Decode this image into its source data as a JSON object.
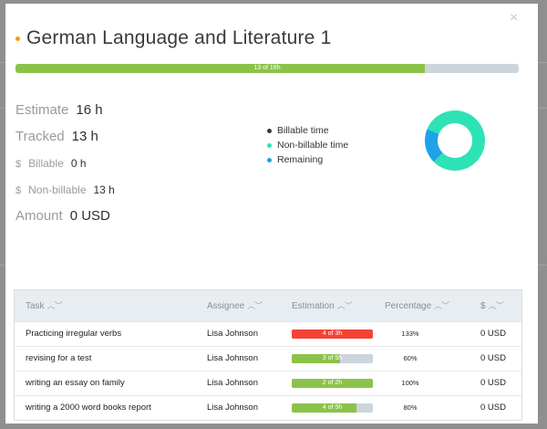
{
  "modal": {
    "title": "German Language and Literature 1",
    "close_glyph": "×",
    "progress": {
      "label": "13 of 16h",
      "fraction": 0.8125,
      "color": "#8bc34a"
    }
  },
  "stats": {
    "estimate": {
      "label": "Estimate",
      "value": "16 h"
    },
    "tracked": {
      "label": "Tracked",
      "value": "13 h"
    },
    "billable": {
      "label": "Billable",
      "value": "0 h",
      "icon": "$"
    },
    "nonbillable": {
      "label": "Non-billable",
      "value": "13 h",
      "icon": "$"
    },
    "amount": {
      "label": "Amount",
      "value": "0 USD"
    }
  },
  "legend": [
    {
      "label": "Billable time",
      "color": "#2f3b45"
    },
    {
      "label": "Non-billable time",
      "color": "#2de3b5"
    },
    {
      "label": "Remaining",
      "color": "#1fa3e8"
    }
  ],
  "donut": {
    "billable": 0,
    "nonbillable": 13,
    "remaining": 3
  },
  "table": {
    "headers": [
      "Task",
      "Assignee",
      "Estimation",
      "Percentage",
      "$"
    ],
    "sort_glyph": "︿﹀",
    "rows": [
      {
        "task": "Practicing irregular verbs",
        "assignee": "Lisa Johnson",
        "estimation": "4 of 3h",
        "fraction": 1.0,
        "color": "#f44336",
        "percentage": "133%",
        "amount": "0 USD"
      },
      {
        "task": "revising for a test",
        "assignee": "Lisa Johnson",
        "estimation": "3 of 5h",
        "fraction": 0.6,
        "color": "#8bc34a",
        "percentage": "60%",
        "amount": "0 USD"
      },
      {
        "task": "writing an essay on family",
        "assignee": "Lisa Johnson",
        "estimation": "2 of 2h",
        "fraction": 1.0,
        "color": "#8bc34a",
        "percentage": "100%",
        "amount": "0 USD"
      },
      {
        "task": "writing a 2000 word books report",
        "assignee": "Lisa Johnson",
        "estimation": "4 of 5h",
        "fraction": 0.8,
        "color": "#8bc34a",
        "percentage": "80%",
        "amount": "0 USD"
      }
    ]
  },
  "accent": "#ff9800"
}
